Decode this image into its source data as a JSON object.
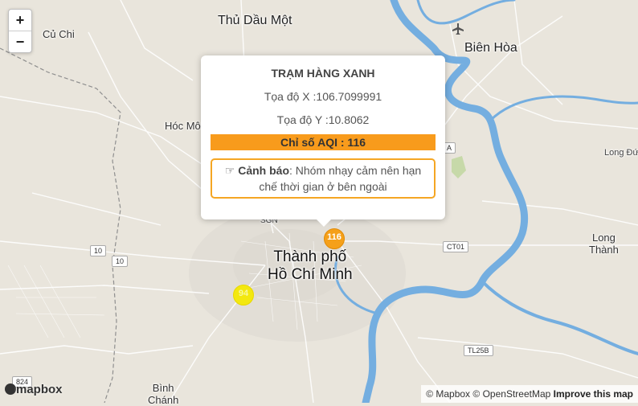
{
  "map": {
    "places": {
      "thu_dau_mot": "Thủ Dầu Một",
      "cu_chi": "Củ Chi",
      "bien_hoa": "Biên Hòa",
      "hoc_mon": "Hóc Mô",
      "long_duc": "Long Đứ",
      "long_thanh_1": "Long",
      "long_thanh_2": "Thành",
      "hcmc_1": "Thành phố",
      "hcmc_2": "Hồ Chí Minh",
      "binh_chanh_1": "Bình",
      "binh_chanh_2": "Chánh",
      "sgn": "SGN"
    },
    "shields": {
      "r10a": "10",
      "r10b": "10",
      "ct01": "CT01",
      "tl25b": "TL25B",
      "r824": "824",
      "a_label": "A"
    },
    "zoom_in": "+",
    "zoom_out": "−"
  },
  "popup": {
    "title": "TRẠM HÀNG XANH",
    "coord_x": "Tọa độ X :106.7099991",
    "coord_y": "Tọa độ Y :10.8062",
    "aqi": "Chỉ số AQI : 116",
    "warning_label": "Cảnh báo",
    "warning_text": ": Nhóm nhạy cảm nên hạn chế thời gian ở bên ngoài",
    "warning_icon": "hand-pointing-icon"
  },
  "markers": [
    {
      "value": "116",
      "color": "#f5a01a"
    },
    {
      "value": "94",
      "color": "#f3e80f"
    }
  ],
  "branding": {
    "logo": "mapbox"
  },
  "attribution": {
    "mapbox": "© Mapbox",
    "osm": "© OpenStreetMap",
    "improve": "Improve this map"
  }
}
